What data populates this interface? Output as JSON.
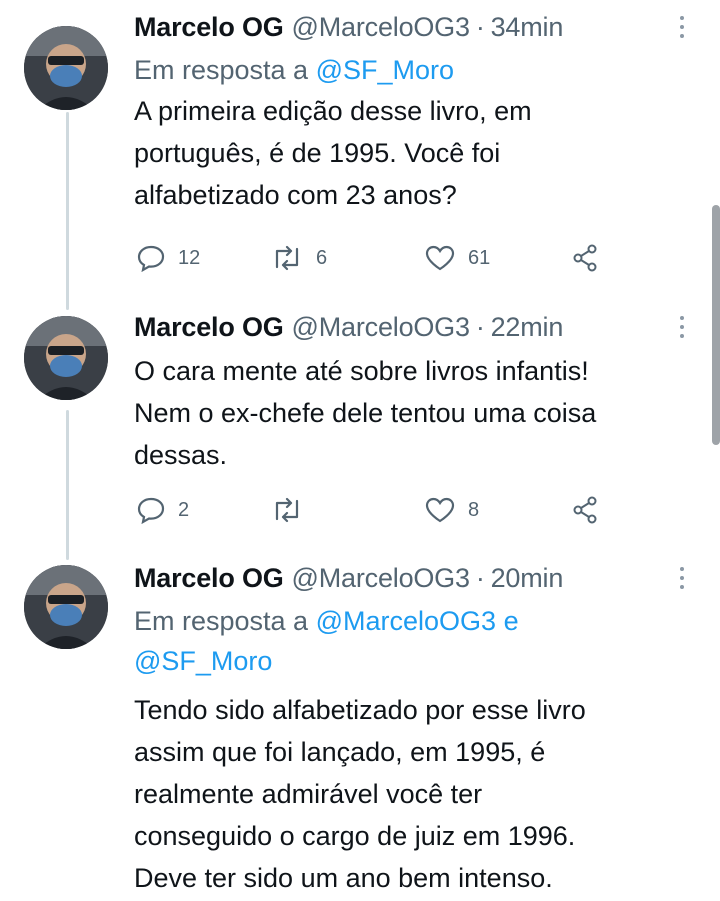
{
  "colors": {
    "link": "#1d9bf0",
    "secondary": "#536471",
    "text": "#0f1419",
    "thread_line": "#cfd9de"
  },
  "tweets": [
    {
      "name": "Marcelo OG",
      "handle": "@MarceloOG3",
      "separator": "·",
      "time": "34min",
      "reply_prefix": "Em resposta a",
      "reply_mentions_line1": "@SF_Moro",
      "reply_connector": "",
      "reply_mentions_line2": "",
      "body_lines": [
        "A primeira edição desse livro, em",
        "português, é de 1995. Você foi",
        "alfabetizado com 23 anos?"
      ],
      "replies": "12",
      "retweets": "6",
      "likes": "61"
    },
    {
      "name": "Marcelo OG",
      "handle": "@MarceloOG3",
      "separator": "·",
      "time": "22min",
      "body_lines": [
        "O cara mente até sobre livros infantis!",
        "Nem o ex-chefe dele tentou uma coisa",
        "dessas."
      ],
      "replies": "2",
      "retweets": "",
      "likes": "8"
    },
    {
      "name": "Marcelo OG",
      "handle": "@MarceloOG3",
      "separator": "·",
      "time": "20min",
      "reply_prefix": "Em resposta a",
      "reply_mentions_line1": "@MarceloOG3",
      "reply_connector": "e",
      "reply_mentions_line2": "@SF_Moro",
      "body_lines": [
        "Tendo sido alfabetizado por esse livro",
        "assim que foi lançado, em 1995, é",
        "realmente admirável você ter",
        "conseguido o cargo de juiz em 1996.",
        "Deve ter sido um ano bem intenso."
      ]
    }
  ],
  "icons": [
    "reply-icon",
    "retweet-icon",
    "like-icon",
    "share-icon",
    "more-icon"
  ]
}
